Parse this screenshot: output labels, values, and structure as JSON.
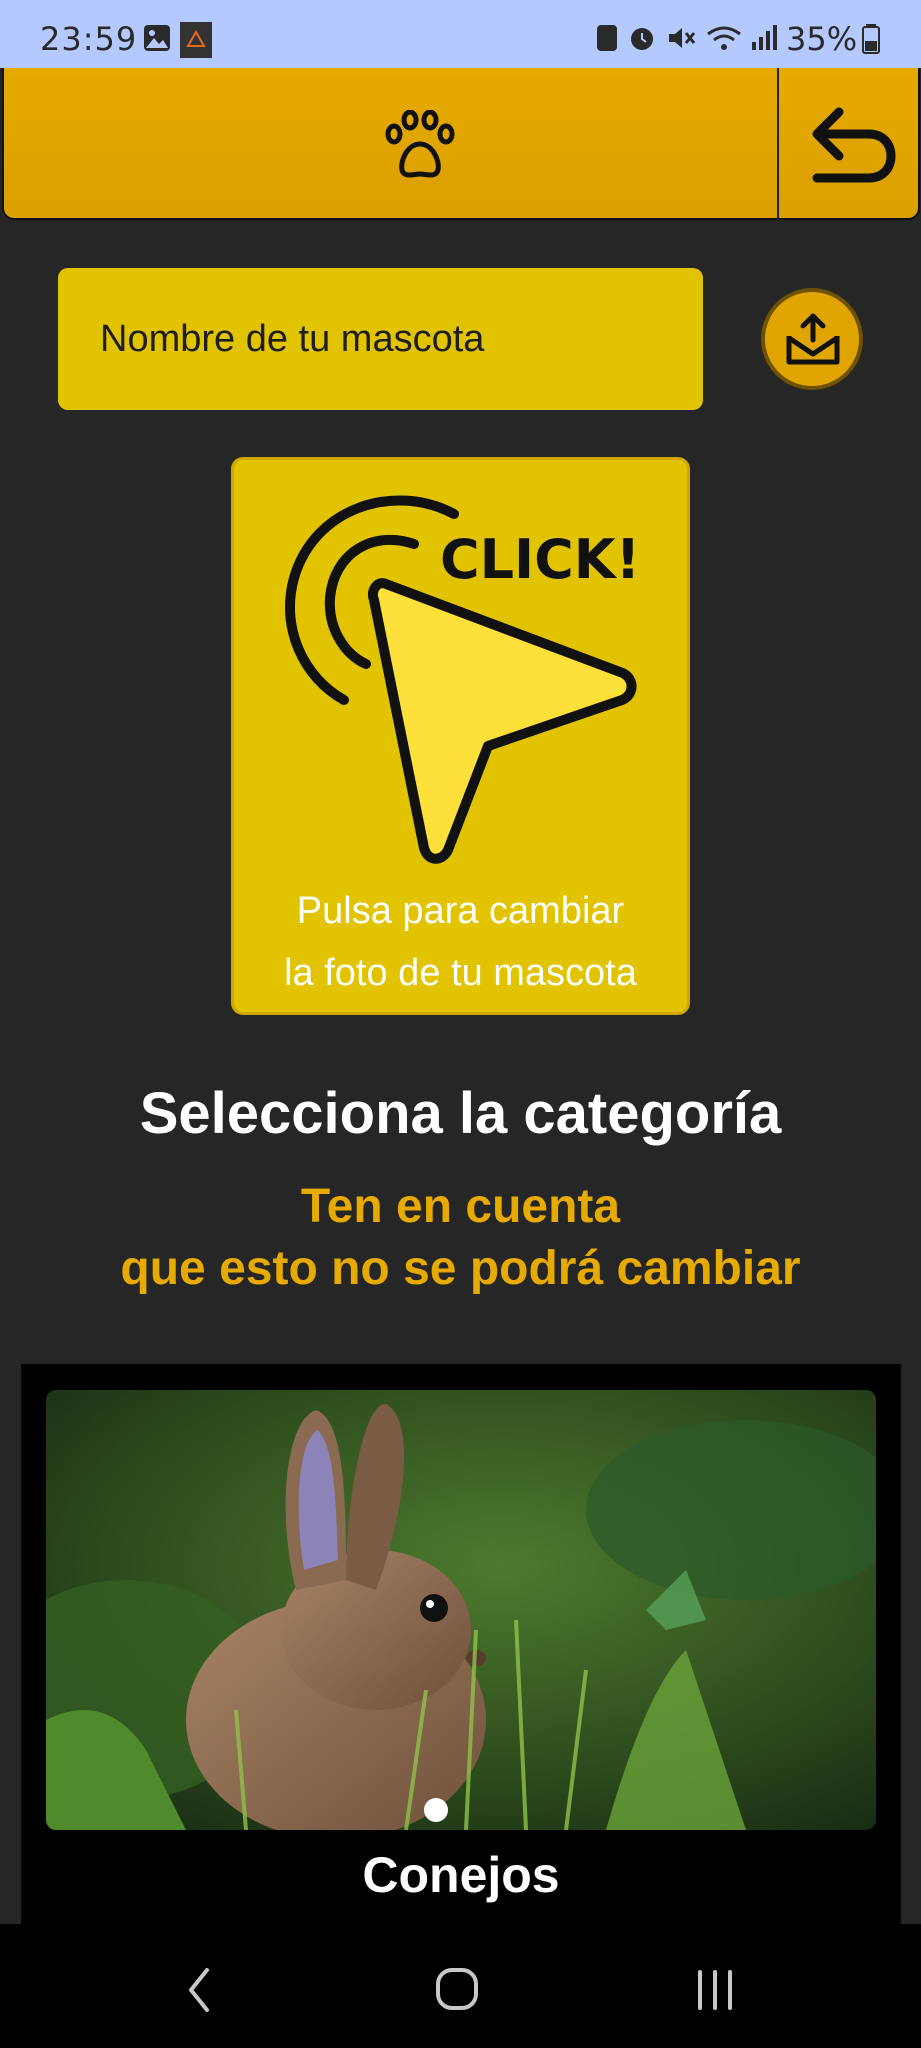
{
  "status_bar": {
    "time": "23:59",
    "battery_percent": "35%",
    "icons": [
      "gallery-icon",
      "app-notification-icon",
      "nfc-icon",
      "alarm-icon",
      "mute-icon",
      "wifi-icon",
      "signal-icon",
      "battery-icon"
    ]
  },
  "header": {
    "center_icon": "paw-icon",
    "back_icon": "back-arrow-icon",
    "accent_color": "#e0a500"
  },
  "pet_form": {
    "name_placeholder": "Nombre de tu mascota",
    "name_value": "",
    "photo_graphic_text": "CLICK!",
    "photo_caption_line1": "Pulsa para cambiar",
    "photo_caption_line2": "la foto de tu mascota",
    "share_icon": "share-upload-icon"
  },
  "category_section": {
    "title": "Selecciona la categoría",
    "warning_line1": "Ten en cuenta",
    "warning_line2": "que esto no se podrá cambiar",
    "categories": [
      {
        "label": "Conejos",
        "image": "rabbit-in-grass"
      }
    ]
  },
  "nav_bar": {
    "buttons": [
      "back-nav-icon",
      "home-nav-icon",
      "recents-nav-icon"
    ]
  }
}
